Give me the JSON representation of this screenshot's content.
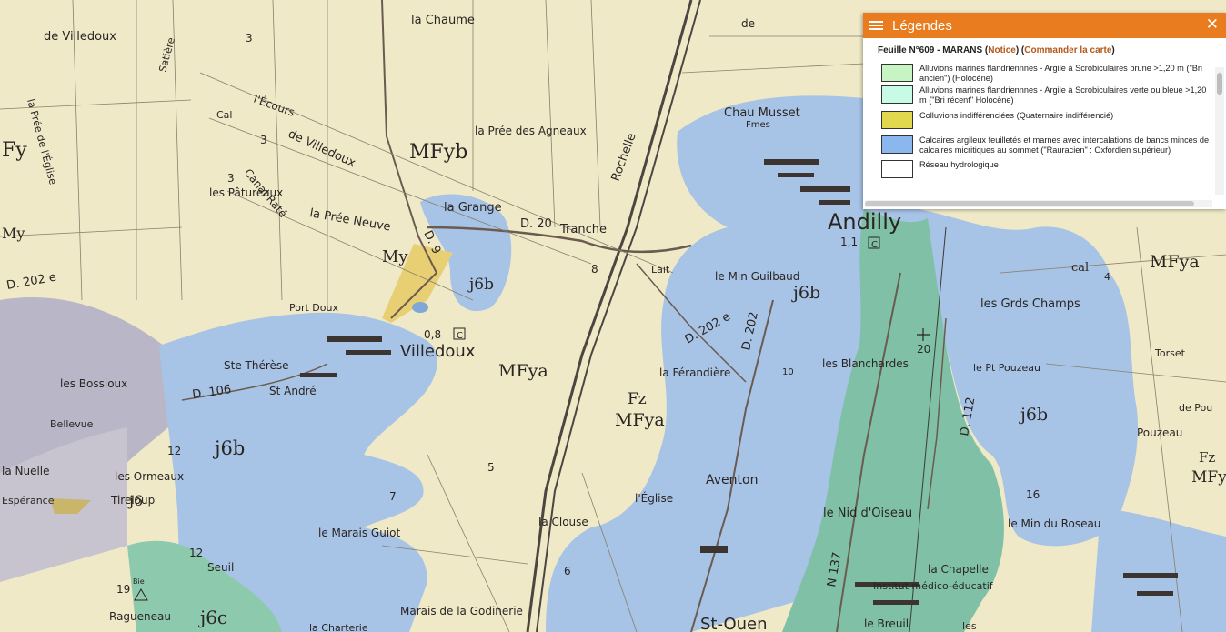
{
  "map": {
    "labels": {
      "la_chaume": "la Chaume",
      "de_villedoux_top": "de Villedoux",
      "la_pree_de_l_eglise": "la Prée de l'Église",
      "satiere": "Satière",
      "l_ecours": "l'Écours",
      "cal_de_villedoux": "de Villedoux",
      "cal": "Cal",
      "canal_rate": "Canal Raté",
      "les_patureaux": "les Pâtureaux",
      "la_pree_neuve": "la Prée Neuve",
      "la_pree_des_agneaux": "la Prée des Agneaux",
      "la_grange": "la Grange",
      "tranche": "Tranche",
      "rochelle": "Rochelle",
      "chau_musset": "Chau Musset",
      "fmes": "Fmes",
      "andilly": "Andilly",
      "laiterie": "Lait",
      "le_min_guilbaud": "le Min Guilbaud",
      "port_doux": "Port Doux",
      "villedoux": "Villedoux",
      "ste_therese": "Ste Thérèse",
      "st_andre": "St André",
      "les_bossioux": "les Bossioux",
      "bellevue": "Bellevue",
      "les_ormeaux": "les Ormeaux",
      "tireloup": "Tireloup",
      "la_nuelle": "la Nuelle",
      "esperance": "Espérance",
      "le_marais_guiot": "le Marais Guiot",
      "seuil": "Seuil",
      "ragueneau": "Ragueneau",
      "marais_de_la_godinerie": "Marais de la Godinerie",
      "la_chartere": "la Charterie",
      "la_clouse": "la Clouse",
      "l_eglise": "l'Église",
      "la_ferandiere": "la Férandière",
      "aventon": "Aventon",
      "les_blanchardes": "les Blanchardes",
      "les_grds_champs": "les Grds Champs",
      "le_pt_pouzeau": "le Pt Pouzeau",
      "pouzeau": "Pouzeau",
      "torset": "Torset",
      "le_nid_d_oiseau": "le Nid d'Oiseau",
      "la_chapelle": "la Chapelle",
      "institut": "Institut médico-éducatif",
      "le_breuil": "le Breuil",
      "le_min_du_roseau": "le Min du Roseau",
      "st_ouen": "St-Ouen",
      "les": "les",
      "de": "de",
      "de_pou": "de Pou"
    },
    "geo_codes": {
      "mfyb": "MFyb",
      "fy_left": "Fy",
      "my_left": "My",
      "my_center": "My",
      "j6b_center": "j6b",
      "mfya_villedoux": "MFya",
      "fz_mfya": "Fz",
      "mfya_mid": "MFya",
      "j6b_andilly": "j6b",
      "mfya_right": "MFya",
      "j6b_right": "j6b",
      "j6b_south": "j6b",
      "j6_west": "j6",
      "j6c": "j6c",
      "cal_code": "cal",
      "fz_right": "Fz",
      "mfy_right": "MFy"
    },
    "roads": {
      "d20": "D. 20",
      "d202e_west": "D. 202 e",
      "d106": "D. 106",
      "d202": "D. 202",
      "d202e_east": "D. 202 e",
      "d112": "D. 112",
      "n137": "N 137",
      "d9": "D. 9"
    },
    "numbers": {
      "n3a": "3",
      "n3b": "3",
      "n3c": "3",
      "n5": "5",
      "n7": "7",
      "n8": "8",
      "n12a": "12",
      "n12b": "12",
      "n6": "6",
      "n16": "16",
      "n20": "20",
      "n11": "1,1",
      "n08": "0,8",
      "n19": "19",
      "n10": "10",
      "bie": "Bie",
      "c_andilly": "C",
      "c_villedoux": "C",
      "n4": "4"
    }
  },
  "legend": {
    "title": "Légendes",
    "close_label": "✕",
    "sheet": {
      "name": "Feuille N°609 - MARANS",
      "notice": "Notice",
      "order": "Commander la carte"
    },
    "items": [
      {
        "color": "#c6f5c3",
        "text": "Alluvions marines flandriennnes - Argile à Scrobiculaires brune >1,20 m (\"Bri ancien\") (Holocène)"
      },
      {
        "color": "#c8fbe5",
        "text": "Alluvions marines flandriennnes - Argile à Scrobiculaires verte ou bleue >1,20 m (\"Bri récent\" Holocène)"
      },
      {
        "color": "#e2d84e",
        "text": "Colluvions indifférenciées (Quaternaire indifférencié)"
      },
      {
        "color": "#8ab8ee",
        "text": "Calcaires argileux feuilletés et marnes avec intercalations de bancs minces de calcaires micritiques au sommet (\"Rauracien\" : Oxfordien supérieur)"
      },
      {
        "color": "#ffffff",
        "text": "Réseau hydrologique"
      }
    ]
  },
  "colors": {
    "map_base": "#efe9c8",
    "limestone_blue": "#a7c3e6",
    "alluvium_green": "#7fc0a6",
    "colluvium_yellow": "#e8cf73",
    "grey_purple": "#b9b6c7",
    "legend_header": "#e87c1e"
  }
}
